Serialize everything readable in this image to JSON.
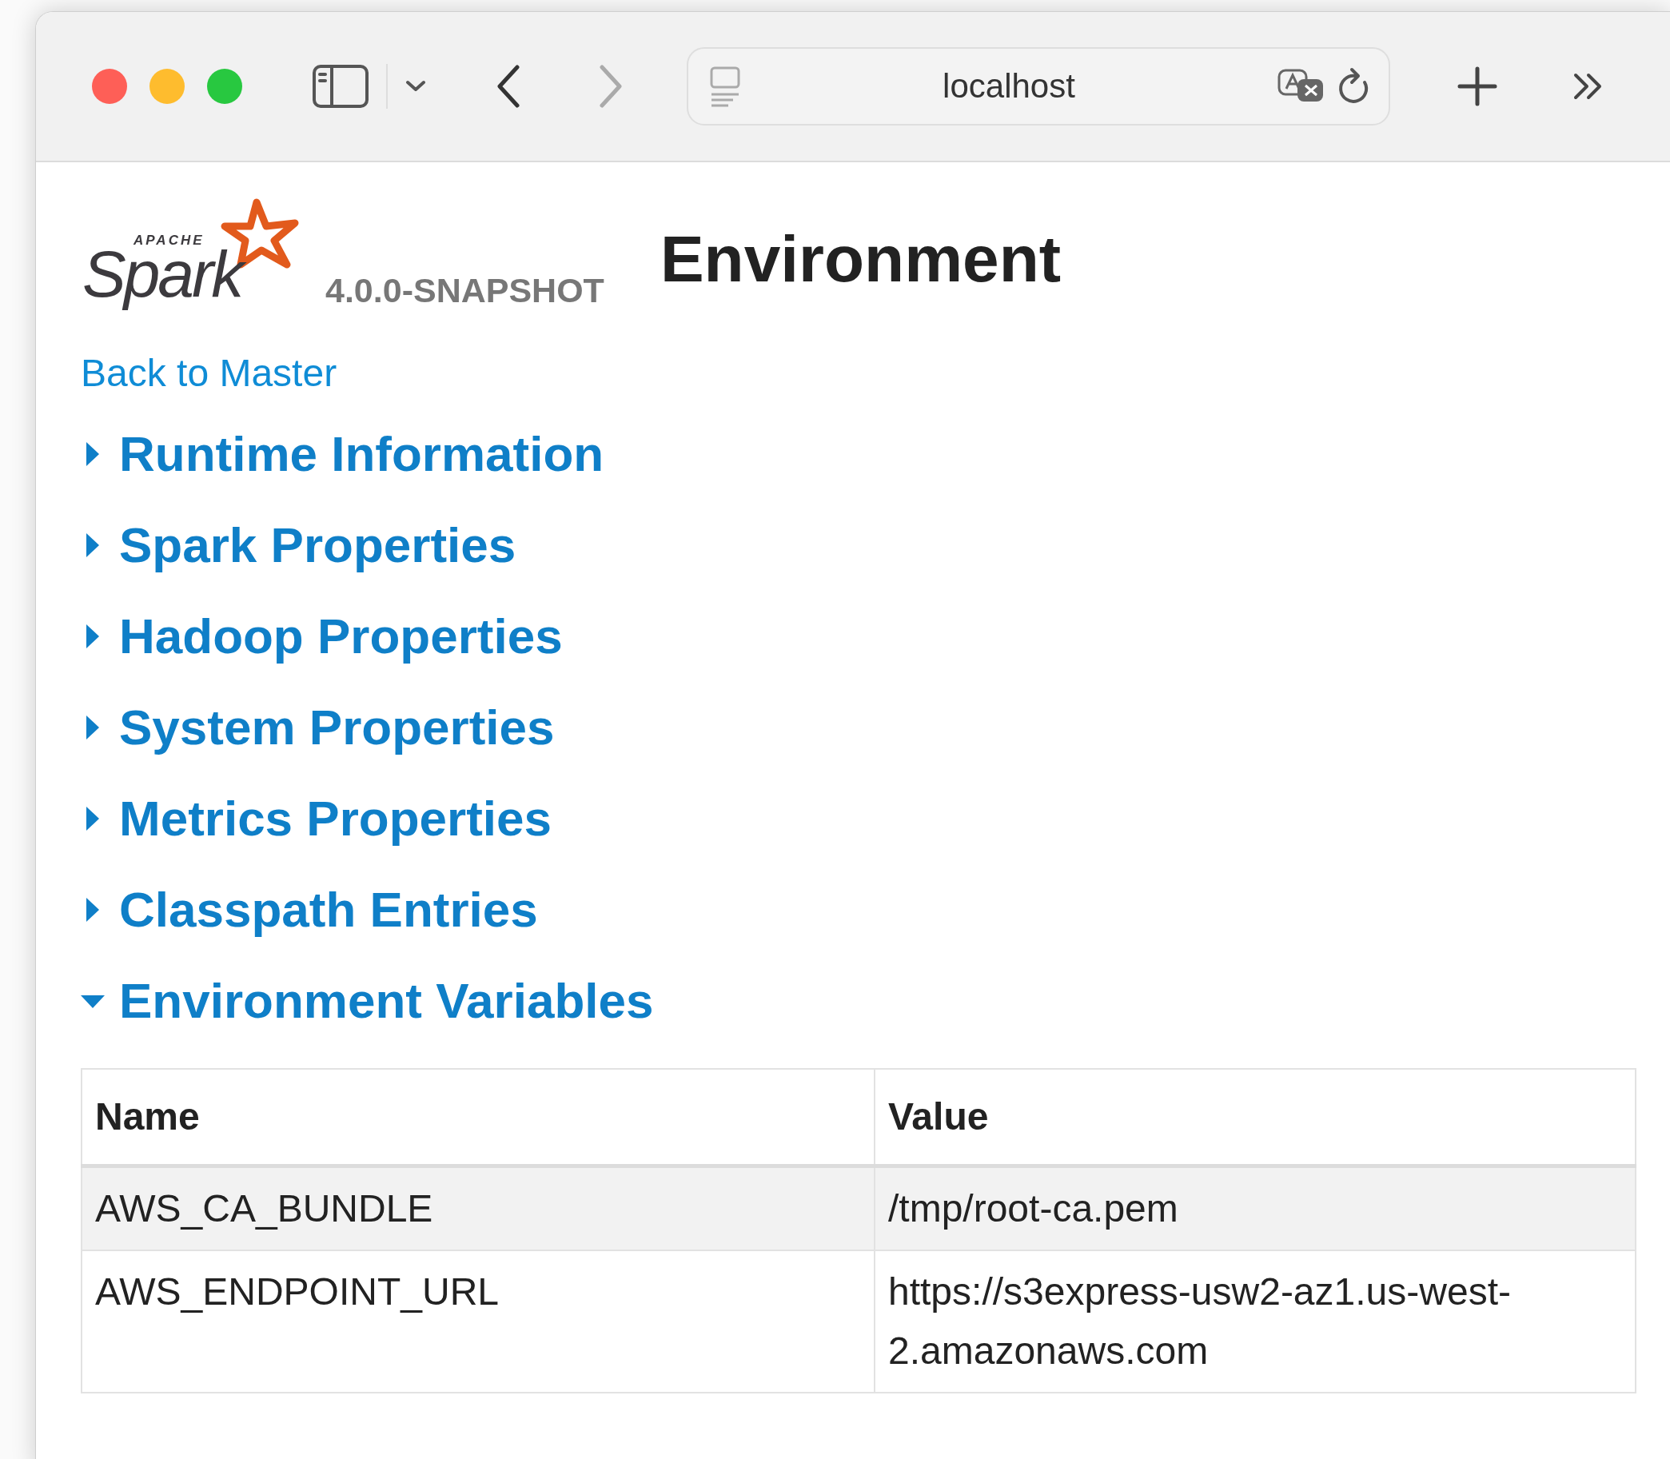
{
  "browser": {
    "address": "localhost"
  },
  "header": {
    "logo_small": "APACHE",
    "logo_word": "Spark",
    "version": "4.0.0-SNAPSHOT",
    "title": "Environment"
  },
  "back_link": "Back to Master",
  "sections": [
    {
      "label": "Runtime Information",
      "expanded": false
    },
    {
      "label": "Spark Properties",
      "expanded": false
    },
    {
      "label": "Hadoop Properties",
      "expanded": false
    },
    {
      "label": "System Properties",
      "expanded": false
    },
    {
      "label": "Metrics Properties",
      "expanded": false
    },
    {
      "label": "Classpath Entries",
      "expanded": false
    },
    {
      "label": "Environment Variables",
      "expanded": true
    }
  ],
  "table": {
    "columns": [
      "Name",
      "Value"
    ],
    "rows": [
      {
        "cells": [
          "AWS_CA_BUNDLE",
          "/tmp/root-ca.pem"
        ]
      },
      {
        "cells": [
          "AWS_ENDPOINT_URL",
          "https://s3express-usw2-az1.us-west-2.amazonaws.com"
        ]
      }
    ]
  }
}
